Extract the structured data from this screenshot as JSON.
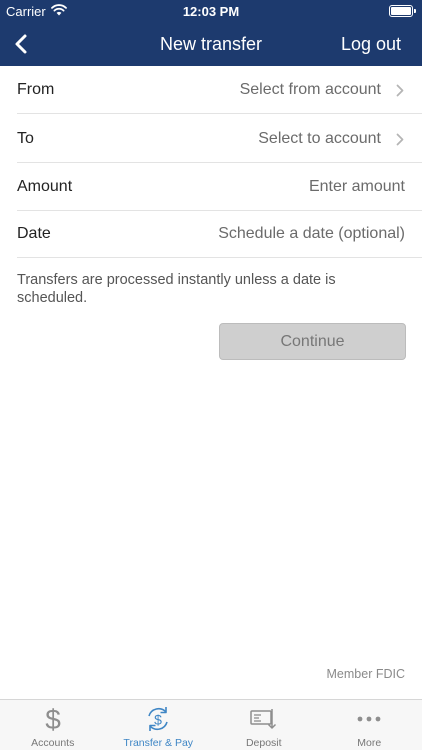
{
  "status_bar": {
    "carrier": "Carrier",
    "time": "12:03 PM"
  },
  "nav": {
    "title": "New transfer",
    "logout": "Log out"
  },
  "form": {
    "from": {
      "label": "From",
      "value": "Select from account"
    },
    "to": {
      "label": "To",
      "value": "Select to account"
    },
    "amount": {
      "label": "Amount",
      "placeholder": "Enter amount"
    },
    "date": {
      "label": "Date",
      "placeholder": "Schedule a date (optional)"
    }
  },
  "info_text": "Transfers are processed instantly unless a date is scheduled.",
  "continue_label": "Continue",
  "footer_note": "Member FDIC",
  "tabs": [
    {
      "label": "Accounts",
      "icon": "dollar-icon"
    },
    {
      "label": "Transfer & Pay",
      "icon": "transfer-pay-icon"
    },
    {
      "label": "Deposit",
      "icon": "deposit-icon"
    },
    {
      "label": "More",
      "icon": "more-icon"
    }
  ],
  "colors": {
    "header": "#1d3a6e",
    "accent": "#3f86c5",
    "button_disabled": "#cfcfcf"
  }
}
